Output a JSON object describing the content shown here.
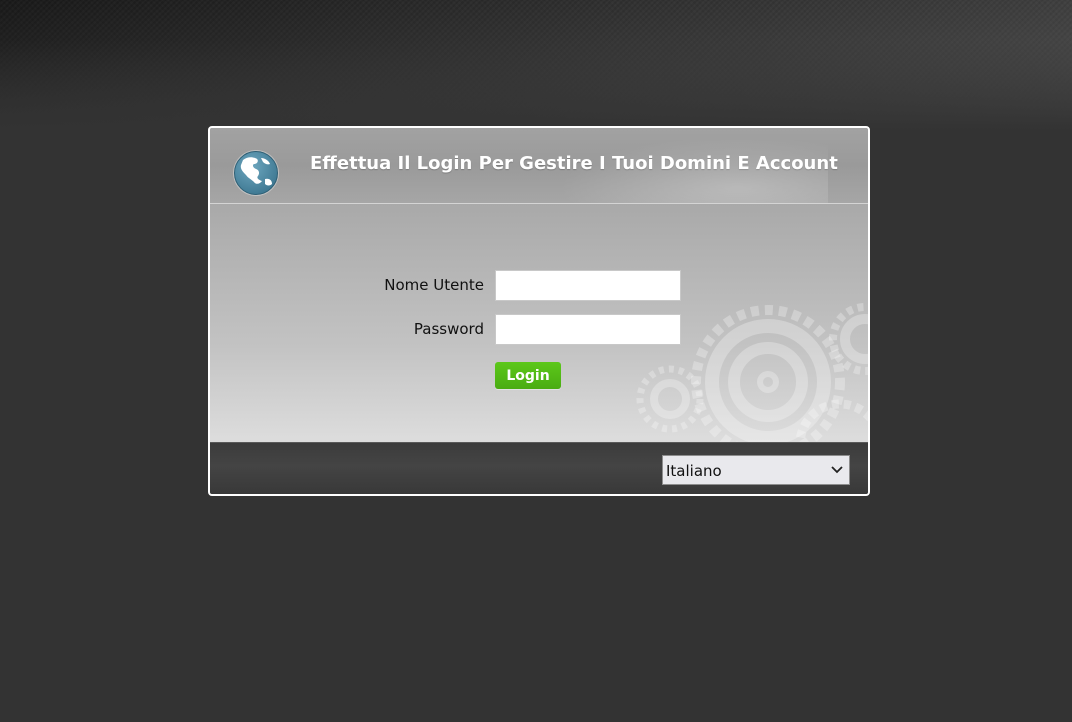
{
  "login": {
    "title": "Effettua Il Login Per Gestire I Tuoi Domini E Account",
    "username_label": "Nome Utente",
    "username_value": "",
    "password_label": "Password",
    "password_value": "",
    "login_button": "Login"
  },
  "footer": {
    "language_selected": "Italiano"
  },
  "icons": {
    "logo": "globe-icon",
    "dropdown": "chevron-down-icon"
  },
  "colors": {
    "page_background": "#333333",
    "login_button": "#52b916",
    "globe": "#4f8aa4"
  }
}
